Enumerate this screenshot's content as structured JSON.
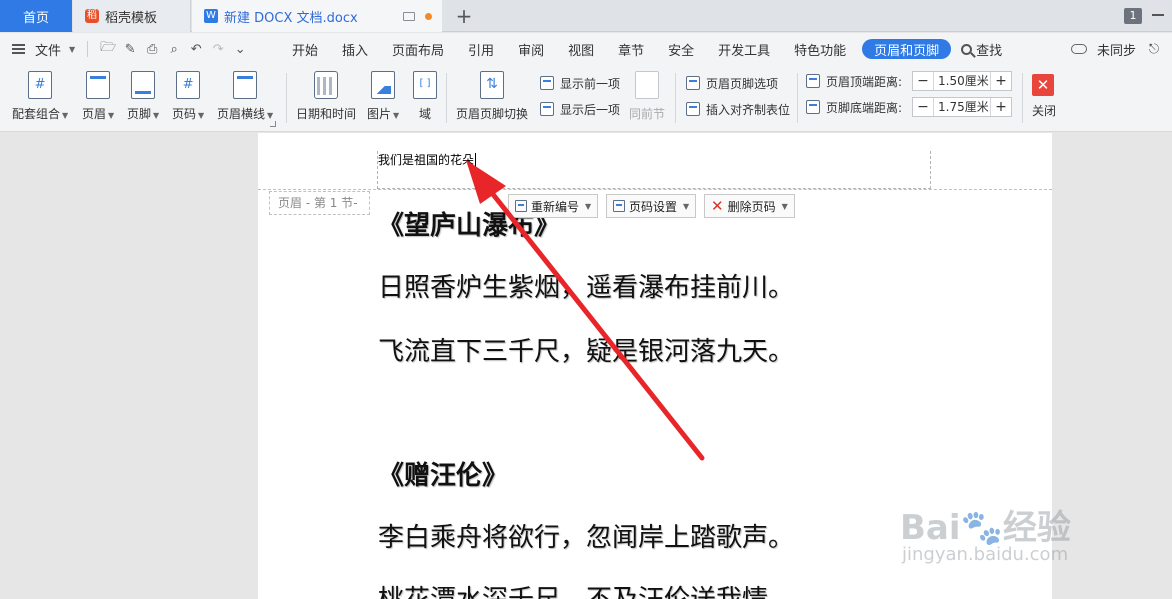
{
  "tabs": {
    "home": "首页",
    "template": "稻壳模板",
    "document": "新建 DOCX 文档.docx",
    "new_tab": "+",
    "window_count": "1"
  },
  "menubar": {
    "file": "文件",
    "items": [
      "开始",
      "插入",
      "页面布局",
      "引用",
      "审阅",
      "视图",
      "章节",
      "安全",
      "开发工具",
      "特色功能",
      "页眉和页脚"
    ],
    "active": "页眉和页脚",
    "find": "查找",
    "sync": "未同步"
  },
  "ribbon": {
    "combo": "配套组合",
    "header": "页眉",
    "footer": "页脚",
    "page_number": "页码",
    "header_line": "页眉横线",
    "date_time": "日期和时间",
    "picture": "图片",
    "field": "域",
    "switch": "页眉页脚切换",
    "show_prev": "显示前一项",
    "show_next": "显示后一项",
    "same_as_prev": "同前节",
    "hf_options": "页眉页脚选项",
    "insert_align_tab": "插入对齐制表位",
    "header_top_distance_label": "页眉顶端距离:",
    "header_top_distance_value": "1.50厘米",
    "footer_bottom_distance_label": "页脚底端距离:",
    "footer_bottom_distance_value": "1.75厘米",
    "minus": "−",
    "plus": "+",
    "close": "关闭",
    "close_icon": "✕"
  },
  "document": {
    "header_text": "我们是祖国的花朵",
    "section_tag": "页眉 - 第 1 节-",
    "renumber": "重新编号",
    "page_number_settings": "页码设置",
    "delete_page_number": "删除页码",
    "poem1_title": "《望庐山瀑布》",
    "poem1_line1": "日照香炉生紫烟，遥看瀑布挂前川。",
    "poem1_line2": "飞流直下三千尺，疑是银河落九天。",
    "poem2_title": "《赠汪伦》",
    "poem2_line1": "李白乘舟将欲行，忽闻岸上踏歌声。",
    "poem2_line2": "桃花潭水深千尺，不及汪伦送我情。"
  },
  "watermark": {
    "brand": "Bai",
    "brand_suffix": "经验",
    "site": "jingyan.baidu.com"
  },
  "colors": {
    "accent": "#2f7ae5",
    "arrow": "#e8262a",
    "close": "#e8453c"
  }
}
